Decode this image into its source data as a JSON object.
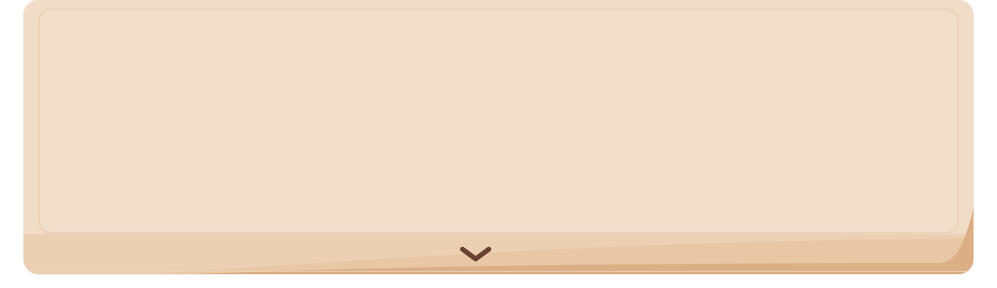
{
  "dialog": {
    "text": "",
    "advance_icon": "chevron-down-icon"
  },
  "colors": {
    "panel_base": "#f1dcc8",
    "panel_inner": "#f0decb",
    "panel_bottom_band": "#e8c8a6",
    "panel_bottom_edge": "#dcae86",
    "chevron": "#6b4230"
  }
}
